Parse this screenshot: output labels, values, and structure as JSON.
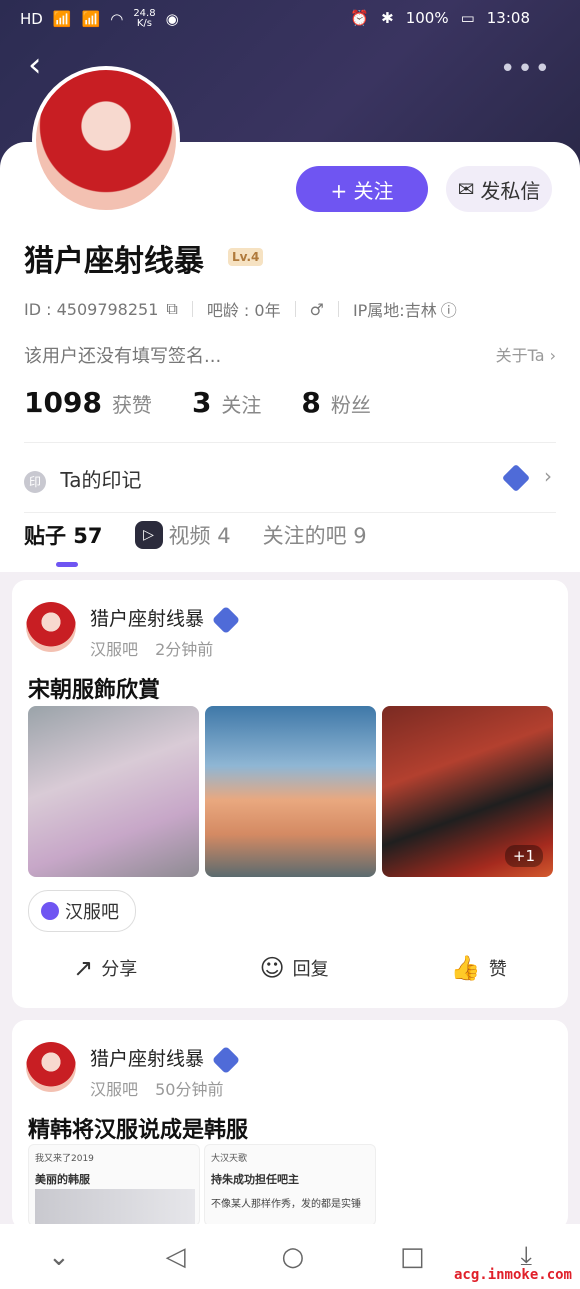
{
  "status_bar": {
    "left_network": "HD",
    "net_speed": "24.8",
    "net_unit": "K/s",
    "battery": "100%",
    "time": "13:08"
  },
  "profile": {
    "username": "猎户座射线暴",
    "level": "Lv.4",
    "follow_label": "+ 关注",
    "message_label": "发私信",
    "id_text": "ID : 4509798251",
    "age_text": "吧龄 : 0年",
    "gender": "♂",
    "ip_text": "IP属地:吉林",
    "signature": "该用户还没有填写签名...",
    "about_label": "关于Ta",
    "stats": [
      {
        "num": "1098",
        "label": "获赞"
      },
      {
        "num": "3",
        "label": "关注"
      },
      {
        "num": "8",
        "label": "粉丝"
      }
    ],
    "mark_label": "Ta的印记",
    "mark_icon": "印"
  },
  "tabs": [
    {
      "label": "贴子 57"
    },
    {
      "label": "视频 4"
    },
    {
      "label": "关注的吧 9"
    }
  ],
  "posts": [
    {
      "author": "猎户座射线暴",
      "forum": "汉服吧",
      "time": "2分钟前",
      "title": "宋朝服飾欣賞",
      "more_count": "+1",
      "forum_chip": "汉服吧",
      "actions": {
        "share": "分享",
        "reply": "回复",
        "like": "赞"
      }
    },
    {
      "author": "猎户座射线暴",
      "forum": "汉服吧",
      "time": "50分钟前",
      "title": "精韩将汉服说成是韩服",
      "shot1": {
        "top": "我又来了2019",
        "heading": "美丽的韩服"
      },
      "shot2": {
        "top": "大汉天歌",
        "heading": "持朱成功担任吧主",
        "body": "不像某人那样作秀，发的都是实锤"
      }
    }
  ],
  "watermark": "acg.inmoke.com",
  "icons": {
    "back": "back-arrow-icon",
    "more": "more-dots-icon"
  }
}
